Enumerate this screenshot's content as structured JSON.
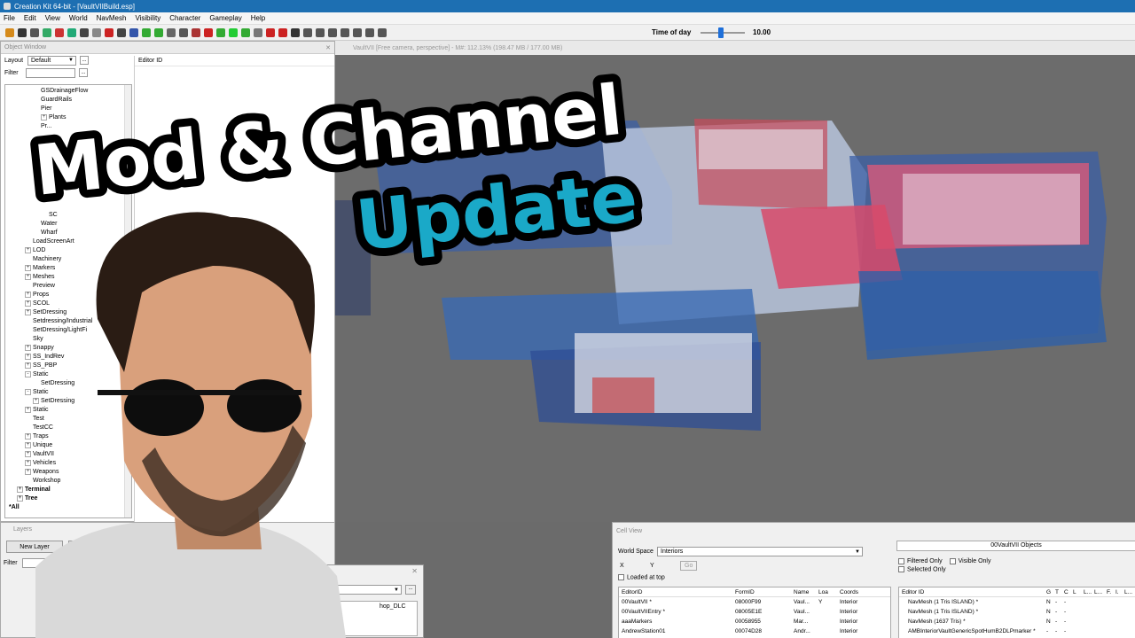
{
  "window": {
    "title": "Creation Kit 64-bit - [VaultVIIBuild.esp]"
  },
  "menu": [
    "File",
    "Edit",
    "View",
    "World",
    "NavMesh",
    "Visibility",
    "Character",
    "Gameplay",
    "Help"
  ],
  "toolbar": {
    "time_of_day_label": "Time of day",
    "time_of_day_value": "10.00",
    "time_of_day_fraction": 0.45,
    "icon_colors": [
      "#d58a1b",
      "#333",
      "#555",
      "#3a6",
      "#c33",
      "#2a7",
      "#444",
      "#888",
      "#c22",
      "#444",
      "#35a",
      "#3a3",
      "#3a3",
      "#666",
      "#555",
      "#a33",
      "#c22",
      "#3a3",
      "#2c3",
      "#3a3",
      "#777",
      "#c22",
      "#c22",
      "#333",
      "#555",
      "#555",
      "#555",
      "#555",
      "#555",
      "#555",
      "#555"
    ]
  },
  "object_window": {
    "title": "Object Window",
    "layout_label": "Layout",
    "layout_value": "Default",
    "filter_label": "Filter",
    "list_header": "Editor ID",
    "tree": [
      {
        "label": "GSDrainageFlow",
        "indent": 4,
        "exp": ""
      },
      {
        "label": "GuardRails",
        "indent": 4,
        "exp": ""
      },
      {
        "label": "Pier",
        "indent": 4,
        "exp": ""
      },
      {
        "label": "Plants",
        "indent": 4,
        "exp": "+"
      },
      {
        "label": "Pr...",
        "indent": 4,
        "exp": ""
      },
      {
        "label": "",
        "indent": 4,
        "exp": ""
      },
      {
        "label": "",
        "indent": 4,
        "exp": ""
      },
      {
        "label": "",
        "indent": 4,
        "exp": ""
      },
      {
        "label": "",
        "indent": 4,
        "exp": ""
      },
      {
        "label": "",
        "indent": 4,
        "exp": ""
      },
      {
        "label": "",
        "indent": 4,
        "exp": ""
      },
      {
        "label": "",
        "indent": 4,
        "exp": ""
      },
      {
        "label": "",
        "indent": 4,
        "exp": ""
      },
      {
        "label": "",
        "indent": 4,
        "exp": ""
      },
      {
        "label": "SC",
        "indent": 5,
        "exp": ""
      },
      {
        "label": "Water",
        "indent": 4,
        "exp": ""
      },
      {
        "label": "Wharf",
        "indent": 4,
        "exp": ""
      },
      {
        "label": "LoadScreenArt",
        "indent": 3,
        "exp": ""
      },
      {
        "label": "LOD",
        "indent": 2,
        "exp": "+"
      },
      {
        "label": "Machinery",
        "indent": 3,
        "exp": ""
      },
      {
        "label": "Markers",
        "indent": 2,
        "exp": "+"
      },
      {
        "label": "Meshes",
        "indent": 2,
        "exp": "+"
      },
      {
        "label": "Preview",
        "indent": 3,
        "exp": ""
      },
      {
        "label": "Props",
        "indent": 2,
        "exp": "+"
      },
      {
        "label": "SCOL",
        "indent": 2,
        "exp": "+"
      },
      {
        "label": "SetDressing",
        "indent": 2,
        "exp": "+"
      },
      {
        "label": "Setdressing/Industrial",
        "indent": 3,
        "exp": ""
      },
      {
        "label": "SetDressing/LightFi",
        "indent": 3,
        "exp": ""
      },
      {
        "label": "Sky",
        "indent": 3,
        "exp": ""
      },
      {
        "label": "Snappy",
        "indent": 2,
        "exp": "+"
      },
      {
        "label": "SS_IndRev",
        "indent": 2,
        "exp": "+"
      },
      {
        "label": "SS_PBP",
        "indent": 2,
        "exp": "+"
      },
      {
        "label": "Static",
        "indent": 2,
        "exp": "-"
      },
      {
        "label": "SetDressing",
        "indent": 4,
        "exp": ""
      },
      {
        "label": "Static",
        "indent": 2,
        "exp": "-"
      },
      {
        "label": "SetDressing",
        "indent": 3,
        "exp": "+"
      },
      {
        "label": "Static",
        "indent": 2,
        "exp": "+"
      },
      {
        "label": "Test",
        "indent": 3,
        "exp": ""
      },
      {
        "label": "TestCC",
        "indent": 3,
        "exp": ""
      },
      {
        "label": "Traps",
        "indent": 2,
        "exp": "+"
      },
      {
        "label": "Unique",
        "indent": 2,
        "exp": "+"
      },
      {
        "label": "VaultVII",
        "indent": 2,
        "exp": "+"
      },
      {
        "label": "Vehicles",
        "indent": 2,
        "exp": "+"
      },
      {
        "label": "Weapons",
        "indent": 2,
        "exp": "+"
      },
      {
        "label": "Workshop",
        "indent": 3,
        "exp": ""
      },
      {
        "label": "Terminal",
        "indent": 1,
        "exp": "+",
        "bold": true
      },
      {
        "label": "Tree",
        "indent": 1,
        "exp": "+",
        "bold": true
      },
      {
        "label": "*All",
        "indent": 0,
        "exp": "",
        "bold": true
      }
    ]
  },
  "viewport": {
    "status": "VaultVII [Free camera, perspective] - M#: 112.13% (198.47 MB / 177.00 MB)"
  },
  "layers": {
    "title": "Layers",
    "new_layer": "New Layer",
    "add_selected": "Add Selec",
    "filter_label": "Filter",
    "dialog_combo": "hop_DLC"
  },
  "cell_view": {
    "title": "Cell View",
    "world_space_label": "World Space",
    "world_space_value": "Interiors",
    "x_label": "X",
    "y_label": "Y",
    "go_label": "Go",
    "loaded_at_top": "Loaded at top",
    "columns": [
      "EditorID",
      "FormID",
      "Name",
      "Loa",
      "Coords"
    ],
    "rows": [
      [
        "00VaultVII *",
        "08000F99",
        "Vaul...",
        "Y",
        "Interior"
      ],
      [
        "00VaultVIIEntry *",
        "08005E1E",
        "Vaul...",
        "",
        "Interior"
      ],
      [
        "aaaMarkers",
        "00058955",
        "Mar...",
        "",
        "Interior"
      ],
      [
        "AndrewStation01",
        "00074D28",
        "Andr...",
        "",
        "Interior"
      ]
    ],
    "objects_title": "00VaultVII Objects",
    "filtered_only": "Filtered Only",
    "visible_only": "Visible Only",
    "selected_only": "Selected Only",
    "obj_columns": [
      "Editor ID",
      "G",
      "T",
      "C",
      "L",
      "L...",
      "L...",
      "F.",
      "I.",
      "L..."
    ],
    "obj_rows": [
      [
        "NavMesh  (1 Tris ISLAND)  *",
        "N",
        "-",
        "-"
      ],
      [
        "NavMesh  (1 Tris ISLAND)  *",
        "N",
        "-",
        "-"
      ],
      [
        "NavMesh  (1637 Tris)  *",
        "N",
        "-",
        "-"
      ],
      [
        "AMBInteriorVaultGenericSpotHumB2DLPmarker *",
        "-",
        "-",
        "-"
      ]
    ]
  },
  "thumbnail": {
    "line1": "Mod & Channel",
    "line2": "Update",
    "accent": "#1aa9c8"
  }
}
